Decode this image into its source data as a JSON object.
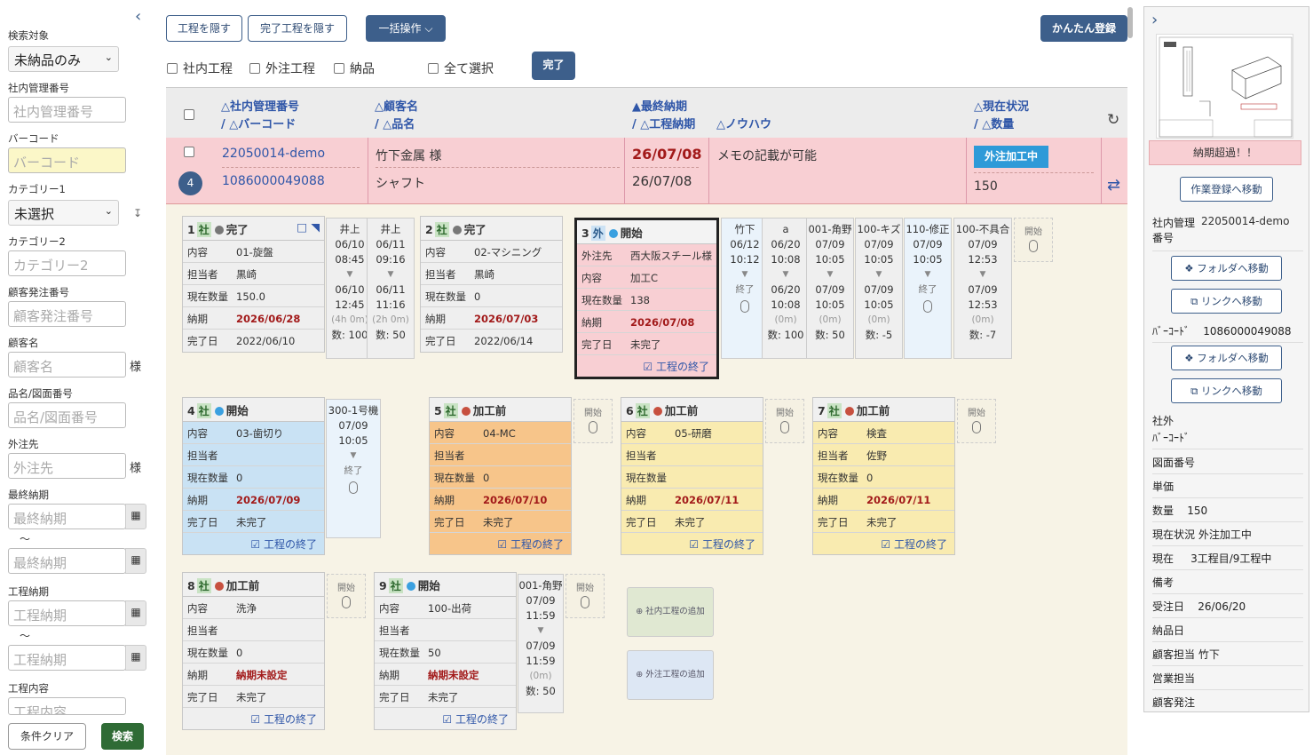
{
  "left": {
    "collapse_icon": "chevron-left-icon",
    "search_target_label": "検索対象",
    "search_target_value": "未納品のみ",
    "mgmt_no_label": "社内管理番号",
    "mgmt_no_placeholder": "社内管理番号",
    "barcode_label": "バーコード",
    "barcode_placeholder": "バーコード",
    "cat1_label": "カテゴリー1",
    "cat1_value": "未選択",
    "cat2_label": "カテゴリー2",
    "cat2_placeholder": "カテゴリー2",
    "cust_order_label": "顧客発注番号",
    "cust_order_placeholder": "顧客発注番号",
    "cust_name_label": "顧客名",
    "cust_name_placeholder": "顧客名",
    "sama": "様",
    "part_label": "品名/図面番号",
    "part_placeholder": "品名/図面番号",
    "vendor_label": "外注先",
    "vendor_placeholder": "外注先",
    "final_due_label": "最終納期",
    "final_due_placeholder": "最終納期",
    "tilde": "〜",
    "proc_due_label": "工程納期",
    "proc_due_placeholder": "工程納期",
    "proc_content_label": "工程内容",
    "proc_content_placeholder": "工程内容",
    "clear_btn": "条件クリア",
    "search_btn": "検索"
  },
  "toolbar": {
    "hide_proc": "工程を隠す",
    "hide_done": "完了工程を隠す",
    "bulk": "一括操作 ⌵",
    "easy_reg": "かんたん登録",
    "cb_internal": "社内工程",
    "cb_external": "外注工程",
    "cb_delivery": "納品",
    "cb_all": "全て選択",
    "done_btn": "完了"
  },
  "header": {
    "c1a": "△社内管理番号",
    "c1b": "/ △バーコード",
    "c2a": "△顧客名",
    "c2b": "/ △品名",
    "c3a": "▲最終納期",
    "c3b": "/ △工程納期",
    "c4": "△ノウハウ",
    "c5a": "△現在状況",
    "c5b": "/ △数量"
  },
  "row": {
    "mgmt_no": "22050014-demo",
    "barcode": "1086000049088",
    "count": "4",
    "customer": "竹下金属 様",
    "part": "シャフト",
    "final_due": "26/07/08",
    "proc_due": "26/07/08",
    "memo": "メモの記載が可能",
    "status": "外注加工中",
    "qty": "150"
  },
  "labels": {
    "content": "内容",
    "person": "担当者",
    "qty": "現在数量",
    "due": "納期",
    "done_date": "完了日",
    "vendor": "外注先",
    "end_proc": "☑ 工程の終了",
    "start": "開始",
    "end": "終了"
  },
  "cards": [
    {
      "no": "1",
      "type": "社",
      "state": "完了",
      "content": "01-旋盤",
      "person": "黒崎",
      "qty": "150.0",
      "due": "2026/06/28",
      "done": "2022/06/10"
    },
    {
      "no": "2",
      "type": "社",
      "state": "完了",
      "content": "02-マシニング",
      "person": "黒崎",
      "qty": "0",
      "due": "2026/07/03",
      "done": "2022/06/14"
    },
    {
      "no": "3",
      "type": "外",
      "state": "開始",
      "vendor": "西大阪スチール様",
      "content": "加工C",
      "qty": "138",
      "due": "2026/07/08",
      "done": "未完了"
    },
    {
      "no": "4",
      "type": "社",
      "state": "開始",
      "content": "03-歯切り",
      "person": "",
      "qty": "0",
      "due": "2026/07/09",
      "done": "未完了"
    },
    {
      "no": "5",
      "type": "社",
      "state": "加工前",
      "content": "04-MC",
      "person": "",
      "qty": "0",
      "due": "2026/07/10",
      "done": "未完了"
    },
    {
      "no": "6",
      "type": "社",
      "state": "加工前",
      "content": "05-研磨",
      "person": "",
      "qty": "",
      "due": "2026/07/11",
      "done": "未完了"
    },
    {
      "no": "7",
      "type": "社",
      "state": "加工前",
      "content": "検査",
      "person": "佐野",
      "qty": "0",
      "due": "2026/07/11",
      "done": "未完了"
    },
    {
      "no": "8",
      "type": "社",
      "state": "加工前",
      "content": "洗浄",
      "person": "",
      "qty": "0",
      "due": "納期未設定",
      "done": "未完了"
    },
    {
      "no": "9",
      "type": "社",
      "state": "開始",
      "content": "100-出荷",
      "person": "",
      "qty": "50",
      "due": "納期未設定",
      "done": "未完了"
    }
  ],
  "logs": [
    {
      "name": "井上",
      "d1": "06/10",
      "t1": "08:45",
      "d2": "06/10",
      "t2": "12:45",
      "dur": "(4h 0m)",
      "n": "数: 100"
    },
    {
      "name": "井上",
      "d1": "06/11",
      "t1": "09:16",
      "d2": "06/11",
      "t2": "11:16",
      "dur": "(2h 0m)",
      "n": "数: 50"
    },
    {
      "name": "竹下",
      "d1": "06/12",
      "t1": "10:12",
      "end": "終了"
    },
    {
      "name": "a",
      "d1": "06/20",
      "t1": "10:08",
      "d2": "06/20",
      "t2": "10:08",
      "dur": "(0m)",
      "n": "数: 100"
    },
    {
      "name": "001-角野",
      "d1": "07/09",
      "t1": "10:05",
      "d2": "07/09",
      "t2": "10:05",
      "dur": "(0m)",
      "n": "数: 50"
    },
    {
      "name": "100-キズ",
      "d1": "07/09",
      "t1": "10:05",
      "d2": "07/09",
      "t2": "10:05",
      "dur": "(0m)",
      "n": "数: -5"
    },
    {
      "name": "110-修正",
      "d1": "07/09",
      "t1": "10:05",
      "end": "終了"
    },
    {
      "name": "100-不具合",
      "d1": "07/09",
      "t1": "12:53",
      "d2": "07/09",
      "t2": "12:53",
      "dur": "(0m)",
      "n": "数: -7"
    },
    {
      "name": "300-1号機",
      "d1": "07/09",
      "t1": "10:05",
      "end": "終了"
    },
    {
      "name": "001-角野",
      "d1": "07/09",
      "t1": "11:59",
      "d2": "07/09",
      "t2": "11:59",
      "dur": "(0m)",
      "n": "数: 50"
    }
  ],
  "add": {
    "internal": "⊕ 社内工程の追加",
    "external": "⊕ 外注工程の追加"
  },
  "right": {
    "overdue": "納期超過！！",
    "to_work": "作業登録へ移動",
    "folder": "❖ フォルダへ移動",
    "link": "⧉ リンクへ移動",
    "mgmt_label": "社内管理番号",
    "mgmt_value": "22050014-demo",
    "barcode_label": "ﾊﾞｰｺｰﾄﾞ",
    "barcode_value": "1086000049088",
    "ext_label": "社外",
    "ext_label2": "ﾊﾞｰｺｰﾄﾞ",
    "drawing": "図面番号",
    "price": "単価",
    "qty_label": "数量",
    "qty_value": "150",
    "status_label": "現在状況",
    "status_value": "外注加工中",
    "current_label": "現在",
    "current_value": "3工程目/9工程中",
    "note": "備考",
    "order_label": "受注日",
    "order_value": "26/06/20",
    "deliv": "納品日",
    "cust_person_label": "顧客担当",
    "cust_person_value": "竹下",
    "sales": "営業担当",
    "cust_order": "顧客発注"
  }
}
